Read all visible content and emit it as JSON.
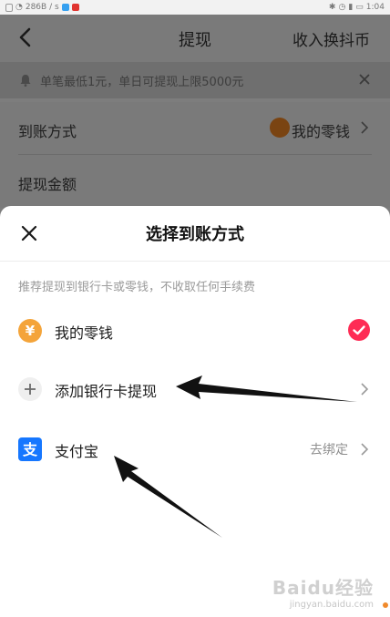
{
  "status_bar": {
    "left_text": "286B / s",
    "time": "1:04"
  },
  "nav": {
    "title": "提现",
    "right_action": "收入换抖币"
  },
  "notice": {
    "text": "单笔最低1元，单日可提现上限5000元"
  },
  "form": {
    "method_label": "到账方式",
    "method_value": "我的零钱",
    "amount_label": "提现金额"
  },
  "sheet": {
    "title": "选择到账方式",
    "tip": "推荐提现到银行卡或零钱，不收取任何手续费",
    "options": [
      {
        "label": "我的零钱",
        "selected": true
      },
      {
        "label": "添加银行卡提现"
      },
      {
        "label": "支付宝",
        "extra": "去绑定"
      }
    ]
  },
  "watermark": {
    "main": "Baidu经验",
    "sub": "jingyan.baidu.com"
  },
  "colors": {
    "accent_red": "#fe2c55",
    "coin_orange": "#f4a43a",
    "alipay_blue": "#1677ff"
  },
  "icons": [
    "back-arrow-icon",
    "bell-icon",
    "close-icon",
    "coin-icon",
    "chevron-right-icon",
    "check-icon",
    "plus-icon",
    "alipay-icon"
  ]
}
